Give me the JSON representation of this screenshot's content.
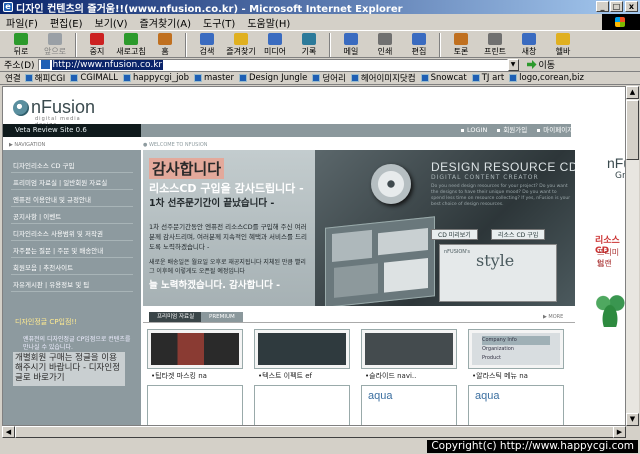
{
  "window": {
    "title": "디자인 컨텐츠의 즐거움!!(www.nfusion.co.kr) - Microsoft Internet Explorer",
    "min": "_",
    "max": "□",
    "close": "x"
  },
  "menu": [
    "파일(F)",
    "편집(E)",
    "보기(V)",
    "즐겨찾기(A)",
    "도구(T)",
    "도움말(H)"
  ],
  "toolbar": [
    {
      "label": "뒤로",
      "icon": "back-arrow-icon",
      "color": "#2c9a2c",
      "disabled": false
    },
    {
      "label": "앞으로",
      "icon": "forward-arrow-icon",
      "color": "#9aa0a6",
      "disabled": true
    },
    {
      "label": "중지",
      "icon": "stop-icon",
      "color": "#cc2222",
      "disabled": false
    },
    {
      "label": "새로고침",
      "icon": "refresh-icon",
      "color": "#2c9a2c",
      "disabled": false
    },
    {
      "label": "홈",
      "icon": "home-icon",
      "color": "#c07020",
      "disabled": false
    },
    {
      "label": "검색",
      "icon": "search-icon",
      "color": "#3a6bc0",
      "disabled": false
    },
    {
      "label": "즐겨찾기",
      "icon": "favorites-icon",
      "color": "#e0b020",
      "disabled": false
    },
    {
      "label": "미디어",
      "icon": "media-icon",
      "color": "#3a6bc0",
      "disabled": false
    },
    {
      "label": "기록",
      "icon": "history-icon",
      "color": "#2c7a9a",
      "disabled": false
    },
    {
      "label": "메일",
      "icon": "mail-icon",
      "color": "#3a6bc0",
      "disabled": false
    },
    {
      "label": "인쇄",
      "icon": "print-icon",
      "color": "#707070",
      "disabled": false
    },
    {
      "label": "편집",
      "icon": "edit-icon",
      "color": "#3a6bc0",
      "disabled": false
    },
    {
      "label": "토론",
      "icon": "discuss-icon",
      "color": "#c07020",
      "disabled": false
    },
    {
      "label": "프린트",
      "icon": "printer-icon",
      "color": "#707070",
      "disabled": false
    },
    {
      "label": "새창",
      "icon": "new-window-icon",
      "color": "#3a6bc0",
      "disabled": false
    },
    {
      "label": "헬바",
      "icon": "helpbar-icon",
      "color": "#e0b020",
      "disabled": false
    }
  ],
  "address": {
    "label": "주소(D)",
    "url": "http://www.nfusion.co.kr",
    "go": "이동"
  },
  "links": {
    "label": "연결",
    "items": [
      "해피CGI",
      "CGIMALL",
      "happycgi_job",
      "master",
      "Design Jungle",
      "덩어리",
      "헤어이미지닷컴",
      "Snowcat",
      "TJ art",
      "logo,corean,biz"
    ]
  },
  "page": {
    "logo": "nFusion",
    "logo_sub": "digital media design",
    "header_left": "Veta Review Site 0.6",
    "header_links": [
      "LOGIN",
      "회원가입",
      "마이페이지"
    ],
    "subhead_left": "▶ NAVIGATION",
    "subhead_mid": "● WELCOME TO NFUSION",
    "nav": [
      "디자인리소스 CD 구입",
      "프리미엄 자료실  |  일반회원 자료실",
      "엔퓨전 이용안내 및 규정안내",
      "공지사항  |  이벤트",
      "디자인리소스 사용범위 및 저작권",
      "자주묻는 질문  |  주문 및 배송안내",
      "회원모음  |  추천사이트",
      "자유게시판  |  유용정보 및 팁"
    ],
    "nav_highlight": "디자인정글 CP입점!!",
    "nav_note": "엔퓨전의 디자인정글 CP입점으로 컨텐츠를 만나실 수 있습니다.",
    "nav_big": "개별회원 구매는 정글을 이용해주시기 바랍니다 - 디자인정글로 바로가기",
    "hero": {
      "thanks": "감사합니다",
      "line1": "리소스CD 구입을 감사드립니다 -",
      "line2": "1차 선주문기간이 끝났습니다 -",
      "p1": "1차 선주문기간동안 엔퓨전 리소스CD를 구입해 주신 여러분께 감사드리며, 여러분께 지속적인 혜택과 서비스를 드리도록 노력하겠습니다 -",
      "p2": "새로운 배송일은 월요일 오후로 재공지됩니다 지체된 만큼 빨리 그 이후에 이렇게도 오픈될 예정입니다",
      "line3": "늘 노력하겠습니다. 감사합니다 -",
      "ds_title": "DESIGN RESOURCE CD",
      "ds_sub": "DIGITAL CONTENT CREATOR",
      "ds_text": "Do you need design resources for your project? Do you want the designs to have their unique mood? Do you want to spend less time on resource collecting? If yes, nFusion is your best choice of design resources.",
      "btn1": "CD 미리보기",
      "btn2": "리소스 CD 구입",
      "style_small": "nFUSION's",
      "style_text": "style"
    },
    "cat_active": "프리미엄 자료실",
    "cat_tab": "PREMIUM",
    "cat_more": "▶ MORE",
    "thumbs": [
      {
        "caption": "•팁타겟 마스킹 na",
        "bg": "#3a3a3a"
      },
      {
        "caption": "•텍스트 이펙트 ef",
        "bg": "#2f3a3e"
      },
      {
        "caption": "•슬라이드 navi..",
        "bg": "#444b4e"
      },
      {
        "caption": "•알라스틱 메뉴 na",
        "bg": "#d8dde0"
      }
    ],
    "thumb2_labels": [
      "",
      "",
      "aqua",
      "aqua"
    ],
    "menu_thumb": [
      "Company Info",
      "Organization",
      "Product"
    ],
    "right": {
      "title": "nFusion",
      "sub": "Grap",
      "red1": "리소스CD",
      "red2": "프리미엄",
      "red3": "브랜"
    }
  },
  "status": {
    "copyright": "Copyright(c) http://www.happycgi.com"
  }
}
